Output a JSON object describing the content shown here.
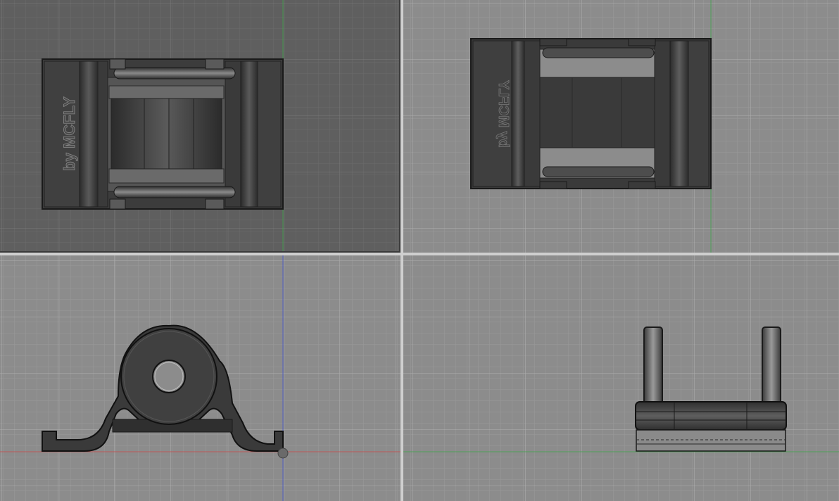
{
  "viewports": {
    "top": {
      "name": "Top",
      "active": true,
      "background": "#5f5f5f"
    },
    "bottom": {
      "name": "Bottom",
      "active": false,
      "background": "#8c8c8c"
    },
    "front": {
      "name": "Front",
      "active": false,
      "background": "#8c8c8c"
    },
    "right": {
      "name": "Right",
      "active": false,
      "background": "#8c8c8c"
    }
  },
  "model": {
    "embossed_text": "by MCFLY",
    "body_color": "#3e3e3e",
    "edge_color": "#1c1c1c"
  },
  "colors": {
    "grid_major": "#a9a9a9",
    "grid_minor": "#9a9a9a",
    "axis_x": "#c84a4a",
    "axis_y": "#3fa64a",
    "axis_z": "#4a5ac8",
    "divider": "#d8d8d8"
  }
}
